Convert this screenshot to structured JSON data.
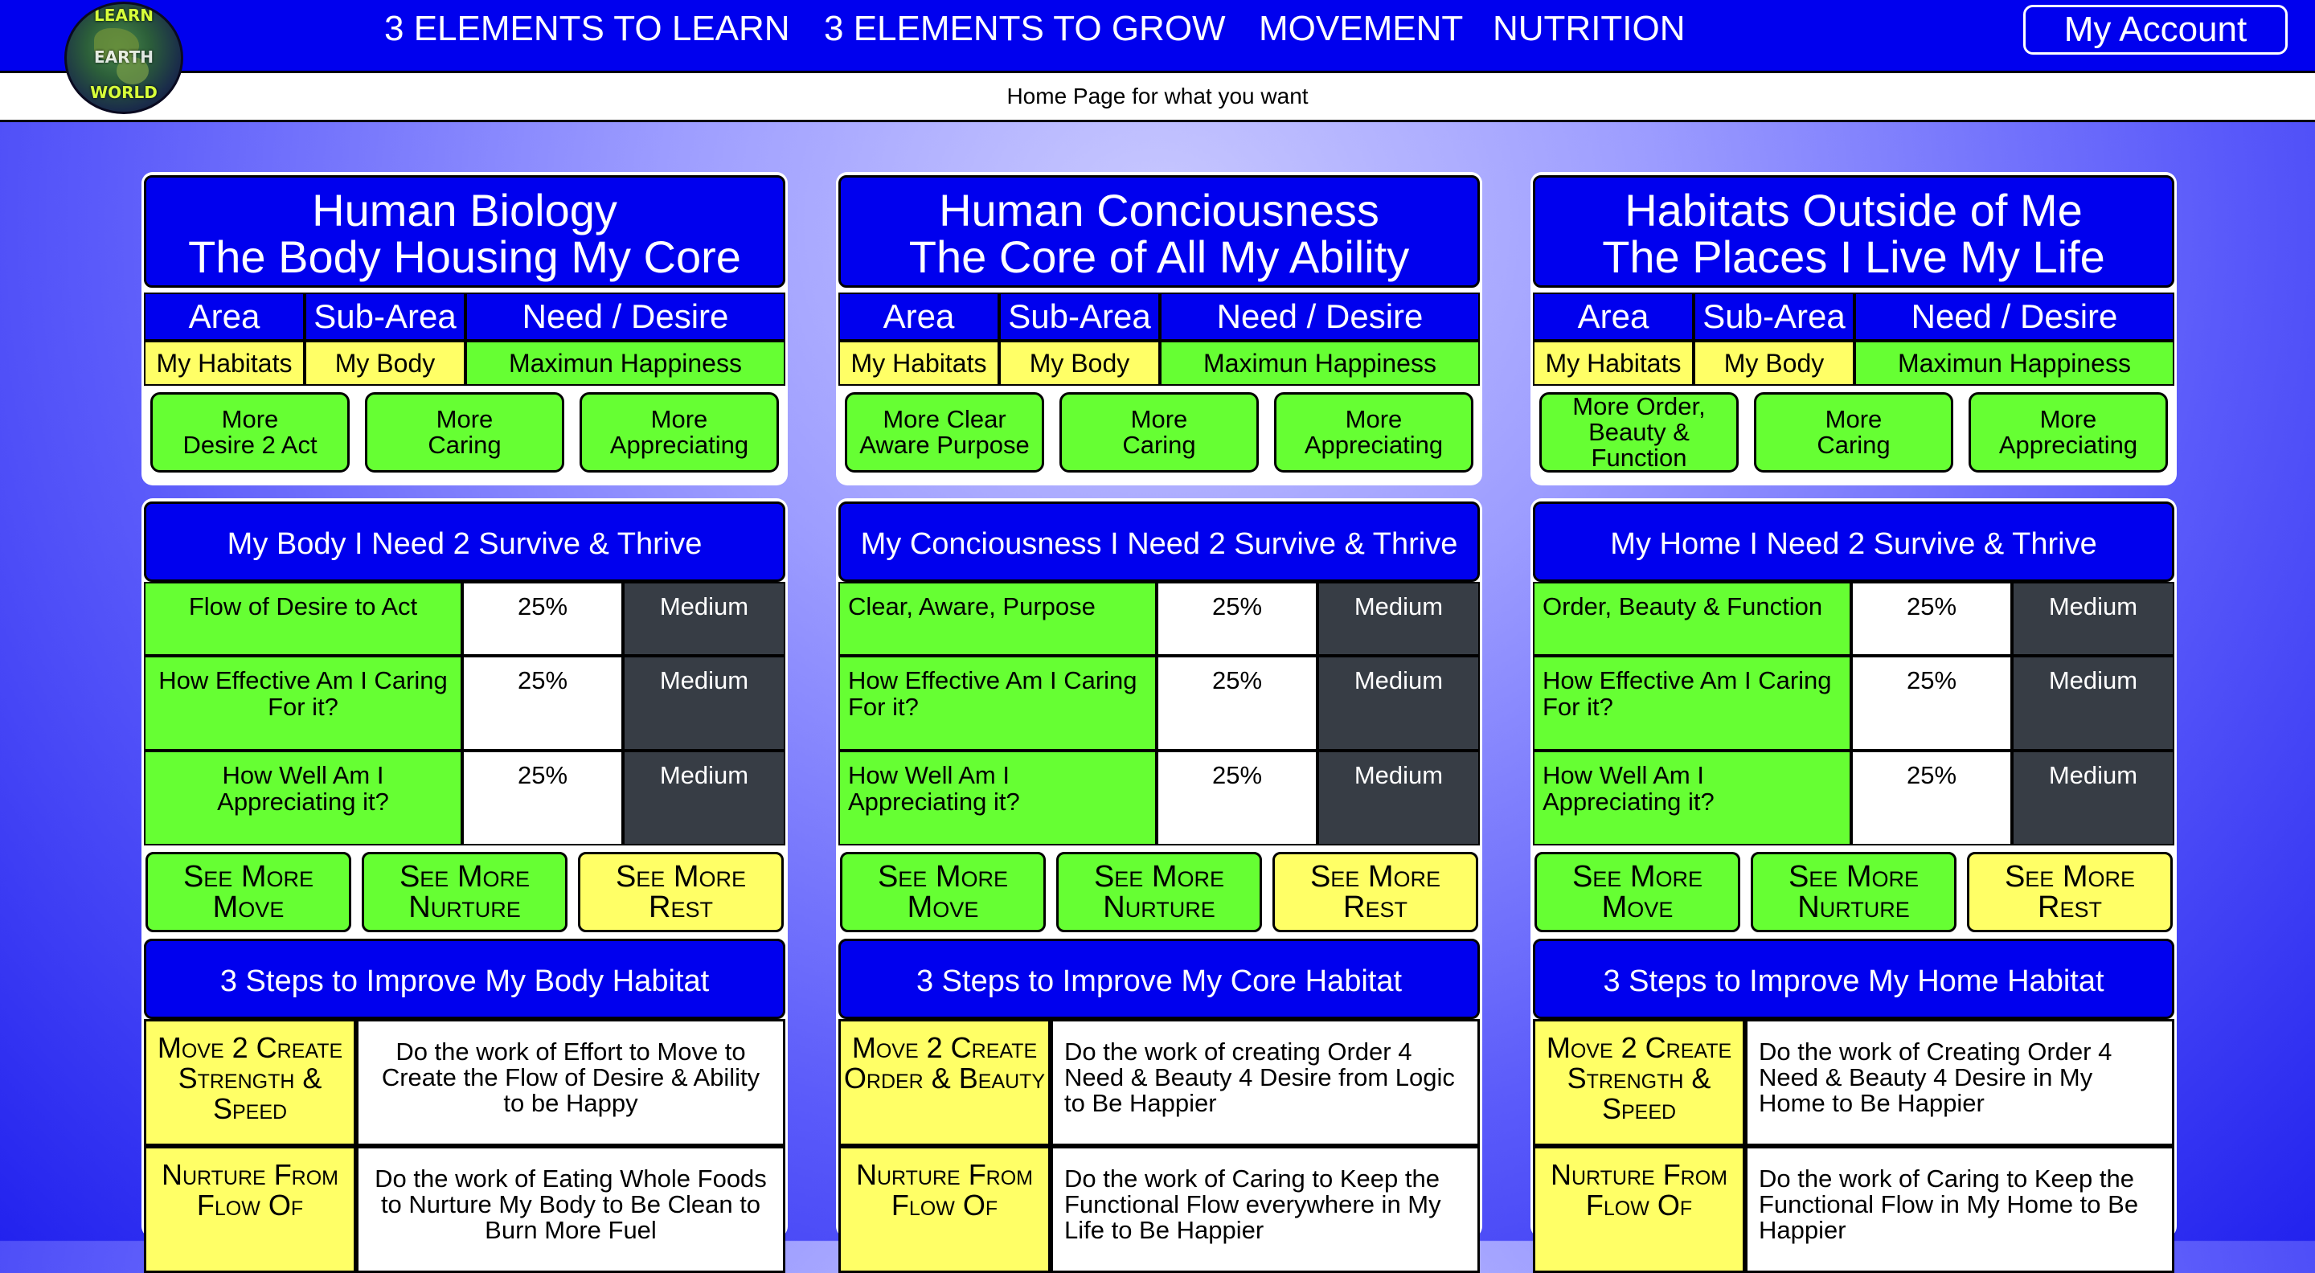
{
  "logo": {
    "top_text": "LEARN",
    "mid_text": "EARTH",
    "bottom_text": "WORLD"
  },
  "nav": {
    "items": [
      "3 ELEMENTS TO LEARN",
      "3 ELEMENTS TO GROW",
      "MOVEMENT",
      "NUTRITION"
    ],
    "account_label": "My Account"
  },
  "subheader": "Home Page for what you want",
  "headers": {
    "area": "Area",
    "sub_area": "Sub-Area",
    "need": "Need / Desire"
  },
  "columns": [
    {
      "title_line1": "Human Biology",
      "title_line2": "The Body Housing My Core",
      "area": "My Habitats",
      "sub_area": "My Body",
      "need": "Maximun Happiness",
      "buttons": [
        "More\nDesire 2 Act",
        "More\nCaring",
        "More\nAppreciating"
      ],
      "section_title": "My Body I Need 2 Survive & Thrive",
      "rows": [
        {
          "label": "Flow of Desire to Act",
          "pct": "25%",
          "level": "Medium"
        },
        {
          "label": "How Effective Am I Caring For it?",
          "pct": "25%",
          "level": "Medium"
        },
        {
          "label": "How Well Am I Appreciating it?",
          "pct": "25%",
          "level": "Medium"
        }
      ],
      "see_more": [
        "See More\nMove",
        "See More\nNurture",
        "See More\nRest"
      ],
      "steps_title": "3 Steps to Improve My Body Habitat",
      "steps": [
        {
          "name": "Move 2 Create Strength & Speed",
          "desc": "Do the work of Effort to Move to Create the Flow of Desire & Ability to be Happy"
        },
        {
          "name": "Nurture From Flow Of",
          "desc": "Do the work of Eating Whole Foods to Nurture My Body to Be Clean to Burn More Fuel"
        }
      ]
    },
    {
      "title_line1": "Human Conciousness",
      "title_line2": "The Core of All My Ability",
      "area": "My Habitats",
      "sub_area": "My Body",
      "need": "Maximun Happiness",
      "buttons": [
        "More Clear\nAware Purpose",
        "More\nCaring",
        "More\nAppreciating"
      ],
      "section_title": "My Conciousness I Need 2 Survive & Thrive",
      "rows": [
        {
          "label": "Clear, Aware, Purpose",
          "pct": "25%",
          "level": "Medium"
        },
        {
          "label": "How Effective Am I Caring For it?",
          "pct": "25%",
          "level": "Medium"
        },
        {
          "label": "How Well Am I Appreciating it?",
          "pct": "25%",
          "level": "Medium"
        }
      ],
      "see_more": [
        "See More\nMove",
        "See More\nNurture",
        "See More\nRest"
      ],
      "steps_title": "3 Steps to Improve My Core Habitat",
      "steps": [
        {
          "name": "Move 2 Create Order & Beauty",
          "desc": "Do the work of creating Order 4 Need & Beauty 4 Desire from Logic to Be Happier"
        },
        {
          "name": "Nurture From Flow Of",
          "desc": "Do the work of Caring to Keep the Functional Flow everywhere in My Life to Be Happier"
        }
      ]
    },
    {
      "title_line1": "Habitats Outside of Me",
      "title_line2": "The Places I Live My Life",
      "area": "My Habitats",
      "sub_area": "My Body",
      "need": "Maximun Happiness",
      "buttons": [
        "More Order,\nBeauty &\nFunction",
        "More\nCaring",
        "More\nAppreciating"
      ],
      "section_title": "My Home I Need 2 Survive & Thrive",
      "rows": [
        {
          "label": "Order, Beauty & Function",
          "pct": "25%",
          "level": "Medium"
        },
        {
          "label": "How Effective Am I Caring For it?",
          "pct": "25%",
          "level": "Medium"
        },
        {
          "label": "How Well Am I Appreciating it?",
          "pct": "25%",
          "level": "Medium"
        }
      ],
      "see_more": [
        "See More\nMove",
        "See More\nNurture",
        "See More\nRest"
      ],
      "steps_title": "3 Steps to Improve My Home Habitat",
      "steps": [
        {
          "name": "Move 2 Create Strength & Speed",
          "desc": "Do the work of Creating Order 4 Need & Beauty 4 Desire in My Home to Be Happier"
        },
        {
          "name": "Nurture From Flow Of",
          "desc": "Do the work of Caring to Keep the Functional Flow in My Home to Be Happier"
        }
      ]
    }
  ],
  "colors": {
    "brand_blue": "#0000ee",
    "action_green": "#66ff33",
    "highlight_yellow": "#ffff66",
    "level_dark": "#373d45"
  }
}
